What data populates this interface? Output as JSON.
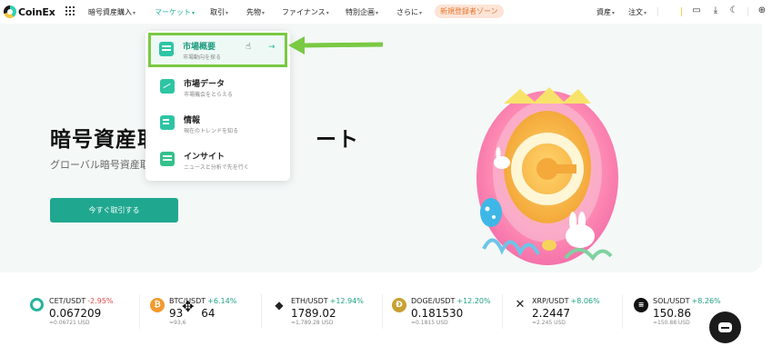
{
  "nav": {
    "logo_text": "CoinEx",
    "items": [
      {
        "label": "暗号資産購入"
      },
      {
        "label": "マーケット"
      },
      {
        "label": "取引"
      },
      {
        "label": "先物"
      },
      {
        "label": "ファイナンス"
      },
      {
        "label": "特別企画"
      },
      {
        "label": "さらに"
      }
    ],
    "badge": "新規登録者ゾーン",
    "assets": "資産",
    "orders": "注文",
    "colors": {
      "accent": "#27b39a",
      "badge_bg": "#fde4d6",
      "badge_fg": "#e4762f"
    }
  },
  "hero": {
    "title": "暗号資産取",
    "title_tail": "ート",
    "subtitle": "グローバル暗号資産取",
    "button": "今すぐ取引する"
  },
  "market_menu": {
    "items": [
      {
        "title": "市場概要",
        "desc": "市場動向を探る",
        "icon": "market-overview-icon"
      },
      {
        "title": "市場データ",
        "desc": "市場機会をとらえる",
        "icon": "market-data-icon"
      },
      {
        "title": "情報",
        "desc": "現在のトレンドを知る",
        "icon": "information-icon"
      },
      {
        "title": "インサイト",
        "desc": "ニュースと分析で先を行く",
        "icon": "insight-icon"
      }
    ]
  },
  "tickers": [
    {
      "pair": "CET/USDT",
      "change": "-2.95%",
      "price": "0.067209",
      "usd": "≈0.06721 USD",
      "icon": "cet-icon",
      "color": "#ffffff"
    },
    {
      "pair": "BTC/USDT",
      "change": "+6.14%",
      "price": "93",
      "price_tail": "64",
      "usd": "≈93,6",
      "icon": "btc-icon",
      "color": "#f29a2e"
    },
    {
      "pair": "ETH/USDT",
      "change": "+12.94%",
      "price": "1789.02",
      "usd": "≈1,789.28 USD",
      "icon": "eth-icon",
      "color": "#ffffff"
    },
    {
      "pair": "DOGE/USDT",
      "change": "+12.20%",
      "price": "0.181530",
      "usd": "≈0.1815 USD",
      "icon": "doge-icon",
      "color": "#c9a033"
    },
    {
      "pair": "XRP/USDT",
      "change": "+8.06%",
      "price": "2.2447",
      "usd": "≈2.245 USD",
      "icon": "xrp-icon",
      "color": "#ffffff"
    },
    {
      "pair": "SOL/USDT",
      "change": "+8.26%",
      "price": "150.86",
      "usd": "≈150.88 USD",
      "icon": "sol-icon",
      "color": "#111111"
    }
  ]
}
